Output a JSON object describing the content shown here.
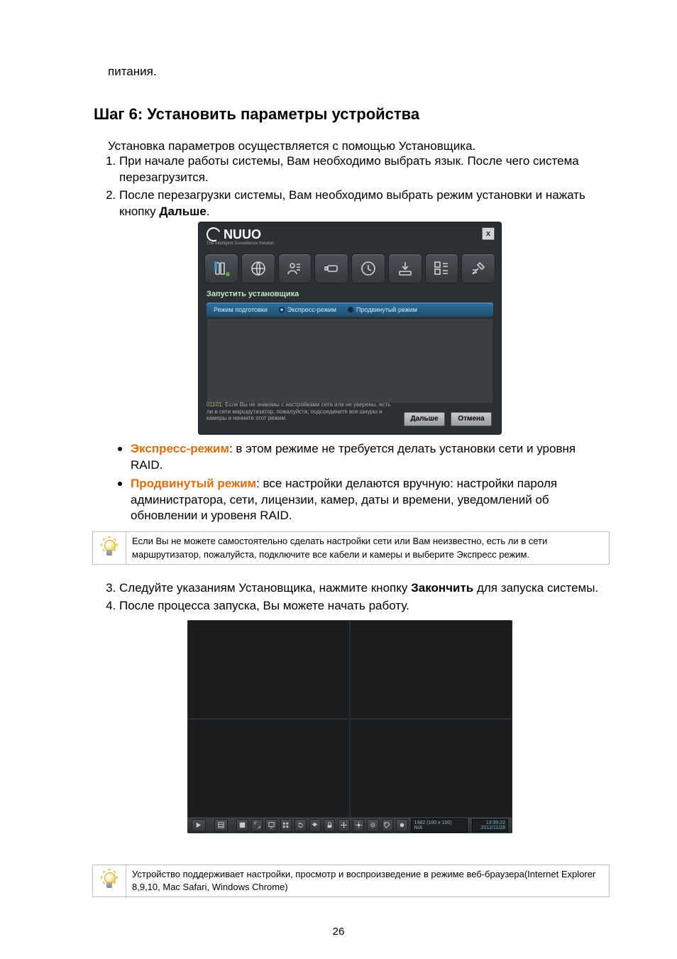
{
  "top_text": "питания.",
  "step_heading": "Шаг 6: Установить параметры устройства",
  "intro": "Установка параметров осуществляется с помощью Установщика.",
  "list1": {
    "i1": "При начале работы системы, Вам необходимо выбрать язык. После чего система перезагрузится.",
    "i2_a": "После перезагрузки системы, Вам необходимо выбрать режим установки и нажать кнопку ",
    "i2_b": "Дальше",
    "i2_c": "."
  },
  "modes": {
    "express_label": "Экспресс-режим",
    "express_text": ": в этом режиме не требуется делать установки сети и уровня RAID.",
    "advanced_label": "Продвинутый режим",
    "advanced_text": ": все настройки делаются вручную: настройки пароля администратора, сети, лицензии, камер, даты и времени, уведомлений об обновлении и уровеня RAID."
  },
  "tip1": "Если Вы не можете самостоятельно сделать настройки сети или Вам неизвестно, есть ли в сети маршрутизатор, пожалуйста, подключите все кабели и камеры и выберите Экспресс режим.",
  "list2": {
    "i3_a": "Следуйте указаниям Установщика, нажмите кнопку   ",
    "i3_b": "Закончить",
    "i3_c": " для запуска системы.",
    "i4": "После процесса запуска, Вы можете начать работу."
  },
  "tip2": "Устройство поддерживает настройки, просмотр и воспроизведение в режиме веб-браузера(Internet Explorer 8,9,10, Mac Safari, Windows Chrome)",
  "page_number": "26",
  "shot1": {
    "logo_text": "NUUO",
    "logo_sub": "The Intelligent Surveillance Solution",
    "close": "x",
    "start_label": "Запустить установщика",
    "mode_prep": "Режим подготовки",
    "mode_express": "Экспресс-режим",
    "mode_adv": "Продвинутый режим",
    "hint_code": "01101:",
    "hint_text": " Если Вы не знакомы с настройками сети или не уверены, есть ли в сети маршрутизатор, пожалуйста, подсоедините все шнуры и камеры и начните этот режим.",
    "btn_next": "Дальше",
    "btn_cancel": "Отмена"
  },
  "shot2": {
    "status_line1": "1982 (100 x 100)",
    "status_line2": "N/A",
    "date_line1": "13:39:22",
    "date_line2": "2012/11/28"
  }
}
